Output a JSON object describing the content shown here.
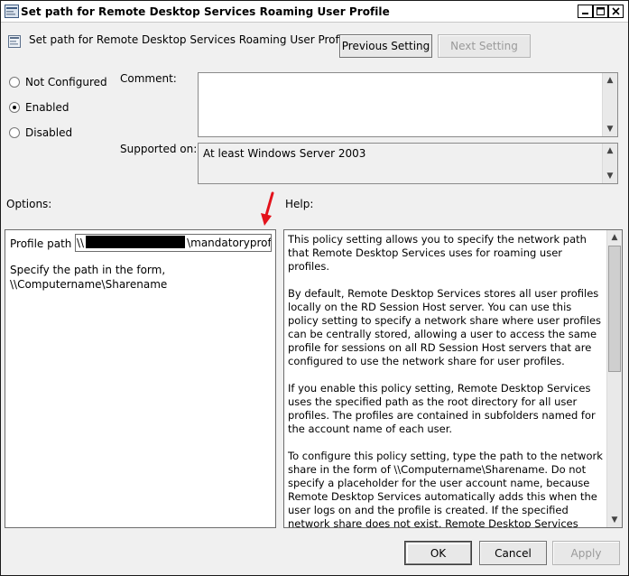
{
  "window": {
    "title": "Set path for Remote Desktop Services Roaming User Profile",
    "minimize_icon": "minimize-icon",
    "maximize_icon": "maximize-icon",
    "close_icon": "close-icon"
  },
  "header": {
    "title": "Set path for Remote Desktop Services Roaming User Profile",
    "previous_label": "Previous Setting",
    "next_label": "Next Setting"
  },
  "state": {
    "options": [
      {
        "label": "Not Configured",
        "selected": false
      },
      {
        "label": "Enabled",
        "selected": true
      },
      {
        "label": "Disabled",
        "selected": false
      }
    ]
  },
  "comment": {
    "label": "Comment:",
    "value": ""
  },
  "supported": {
    "label": "Supported on:",
    "value": "At least Windows Server 2003"
  },
  "options_section": {
    "label": "Options:",
    "profile_path_label": "Profile path",
    "profile_path_prefix": "\\\\",
    "profile_path_suffix": "\\mandatoryprofile",
    "hint_line1": "Specify the path in the form,",
    "hint_line2": "\\\\Computername\\Sharename"
  },
  "help_section": {
    "label": "Help:",
    "paragraphs": [
      "This policy setting allows you to specify the network path that Remote Desktop Services uses for roaming user profiles.",
      "By default, Remote Desktop Services stores all user profiles locally on the RD Session Host server. You can use this policy setting to specify a network share where user profiles can be centrally stored, allowing a user to access the same profile for sessions on all RD Session Host servers that are configured to use the network share for user profiles.",
      "If you enable this policy setting, Remote Desktop Services uses the specified path as the root directory for all user profiles. The profiles are contained in subfolders named for the account name of each user.",
      "To configure this policy setting, type the path to the network share in the form of \\\\Computername\\Sharename. Do not specify a placeholder for the user account name, because Remote Desktop Services automatically adds this when the user logs on and the profile is created. If the specified network share does not exist, Remote Desktop Services displays an error message on the"
    ]
  },
  "footer": {
    "ok_label": "OK",
    "cancel_label": "Cancel",
    "apply_label": "Apply"
  },
  "colors": {
    "annotation_arrow": "#e3121b"
  }
}
